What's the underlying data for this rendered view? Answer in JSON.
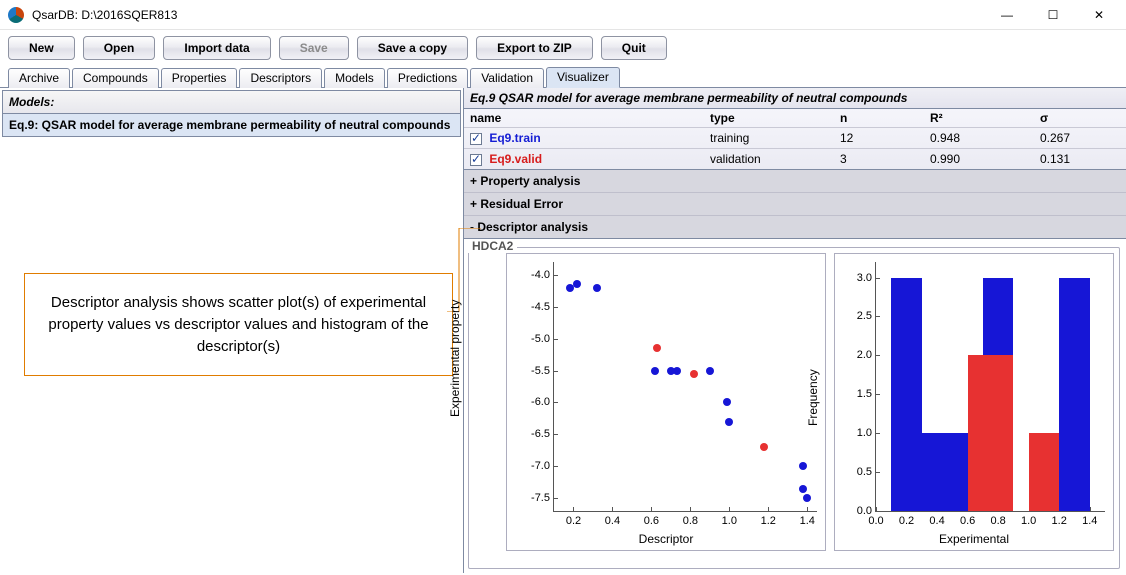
{
  "window": {
    "title": "QsarDB: D:\\2016SQER813"
  },
  "toolbar": {
    "new_label": "New",
    "open_label": "Open",
    "import_label": "Import data",
    "save_label": "Save",
    "save_copy_label": "Save a copy",
    "export_label": "Export to ZIP",
    "quit_label": "Quit"
  },
  "tabs": {
    "archive": "Archive",
    "compounds": "Compounds",
    "properties": "Properties",
    "descriptors": "Descriptors",
    "models": "Models",
    "predictions": "Predictions",
    "validation": "Validation",
    "visualizer": "Visualizer"
  },
  "models_panel": {
    "heading": "Models:",
    "selected_model": "Eq.9: QSAR model for average membrane permeability of neutral compounds"
  },
  "callout": {
    "text": "Descriptor analysis shows scatter plot(s) of experimental property values vs descriptor values and histogram of the descriptor(s)"
  },
  "right": {
    "header": "Eq.9 QSAR model for average membrane permeability of neutral compounds",
    "columns": {
      "name": "name",
      "type": "type",
      "n": "n",
      "r2": "R²",
      "sigma": "σ"
    },
    "sets": [
      {
        "checked": true,
        "name": "Eq9.train",
        "kind": "train",
        "type": "training",
        "n": "12",
        "r2": "0.948",
        "sigma": "0.267"
      },
      {
        "checked": true,
        "name": "Eq9.valid",
        "kind": "valid",
        "type": "validation",
        "n": "3",
        "r2": "0.990",
        "sigma": "0.131"
      }
    ],
    "sections": {
      "property": "+ Property analysis",
      "residual": "+ Residual Error",
      "descriptor": "- Descriptor analysis"
    },
    "descriptor_label": "HDCA2"
  },
  "chart_data": [
    {
      "type": "scatter",
      "title": "",
      "xlabel": "Descriptor",
      "ylabel": "Experimental property",
      "xlim": [
        0.1,
        1.45
      ],
      "ylim": [
        -7.7,
        -3.8
      ],
      "xticks": [
        0.2,
        0.4,
        0.6,
        0.8,
        1.0,
        1.2,
        1.4
      ],
      "yticks": [
        -4.0,
        -4.5,
        -5.0,
        -5.5,
        -6.0,
        -6.5,
        -7.0,
        -7.5
      ],
      "series": [
        {
          "name": "train",
          "color": "blue",
          "points": [
            [
              0.18,
              -4.2
            ],
            [
              0.22,
              -4.15
            ],
            [
              0.32,
              -4.2
            ],
            [
              0.62,
              -5.5
            ],
            [
              0.7,
              -5.5
            ],
            [
              0.73,
              -5.5
            ],
            [
              0.9,
              -5.5
            ],
            [
              0.99,
              -6.0
            ],
            [
              1.0,
              -6.3
            ],
            [
              1.38,
              -7.0
            ],
            [
              1.38,
              -7.35
            ],
            [
              1.4,
              -7.5
            ]
          ]
        },
        {
          "name": "valid",
          "color": "red",
          "points": [
            [
              0.63,
              -5.15
            ],
            [
              0.82,
              -5.55
            ],
            [
              1.18,
              -6.7
            ]
          ]
        }
      ]
    },
    {
      "type": "bar",
      "title": "",
      "xlabel": "Experimental",
      "ylabel": "Frequency",
      "xlim": [
        0.0,
        1.5
      ],
      "ylim": [
        0.0,
        3.2
      ],
      "xticks": [
        0.0,
        0.2,
        0.4,
        0.6,
        0.8,
        1.0,
        1.2,
        1.4
      ],
      "yticks": [
        0.0,
        0.5,
        1.0,
        1.5,
        2.0,
        2.5,
        3.0
      ],
      "bin_width": 0.2,
      "bars": {
        "blue": [
          {
            "x": 0.1,
            "w": 0.2,
            "y": 3
          },
          {
            "x": 0.3,
            "w": 0.2,
            "y": 1
          },
          {
            "x": 0.5,
            "w": 0.1,
            "y": 1
          },
          {
            "x": 0.7,
            "w": 0.2,
            "y": 3
          },
          {
            "x": 1.2,
            "w": 0.2,
            "y": 3
          }
        ],
        "red": [
          {
            "x": 0.6,
            "w": 0.1,
            "y": 2
          },
          {
            "x": 0.7,
            "w": 0.2,
            "y": 2
          },
          {
            "x": 1.0,
            "w": 0.2,
            "y": 1
          }
        ]
      }
    }
  ]
}
